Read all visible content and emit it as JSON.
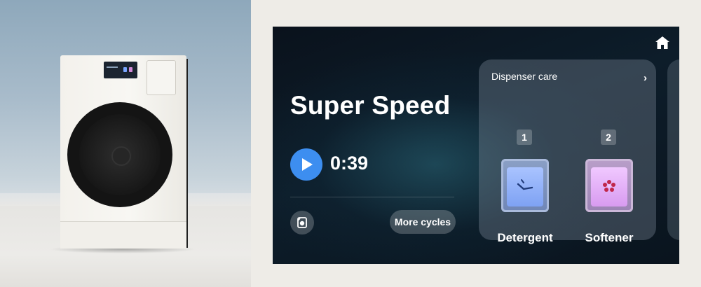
{
  "display": {
    "cycle_name": "Super Speed",
    "remaining_time": "0:39",
    "more_cycles_label": "More cycles"
  },
  "dispenser_card": {
    "title": "Dispenser care",
    "slots": [
      {
        "number": "1",
        "label": "Detergent",
        "color": "#7ea2f3",
        "icon": "detergent-icon"
      },
      {
        "number": "2",
        "label": "Softener",
        "color": "#d89bf0",
        "icon": "softener-icon"
      }
    ]
  },
  "icons": {
    "home": "home-icon",
    "play": "play-icon",
    "cycle_settings": "washer-settings-icon",
    "chevron": "chevron-right-icon"
  },
  "colors": {
    "accent": "#3d8ef0",
    "screen_background": "#0b1620"
  }
}
